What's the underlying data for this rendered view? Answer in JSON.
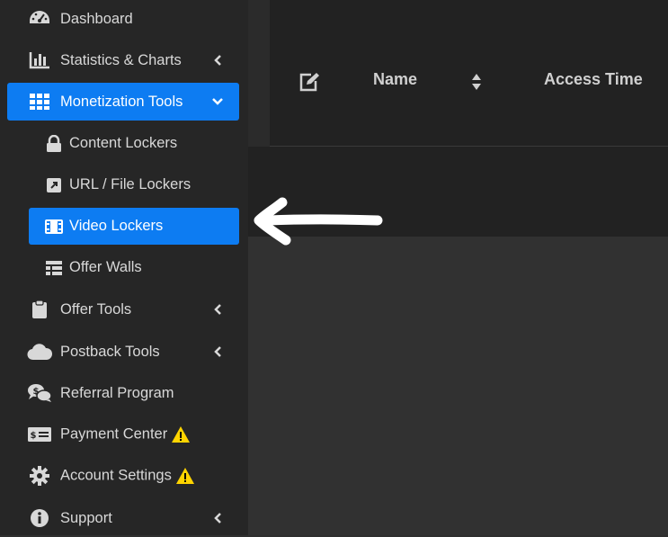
{
  "sidebar": {
    "items": [
      {
        "label": "Dashboard",
        "icon": "dashboard-gauge-icon"
      },
      {
        "label": "Statistics & Charts",
        "icon": "bar-chart-icon"
      },
      {
        "label": "Monetization Tools",
        "icon": "grid-icon",
        "active": true
      },
      {
        "label": "Content Lockers",
        "icon": "lock-icon"
      },
      {
        "label": "URL / File Lockers",
        "icon": "external-link-icon"
      },
      {
        "label": "Video Lockers",
        "icon": "film-icon",
        "active": true
      },
      {
        "label": "Offer Walls",
        "icon": "table-icon"
      },
      {
        "label": "Offer Tools",
        "icon": "clipboard-icon"
      },
      {
        "label": "Postback Tools",
        "icon": "cloud-icon"
      },
      {
        "label": "Referral Program",
        "icon": "chat-dollar-icon"
      },
      {
        "label": "Payment Center",
        "icon": "money-card-icon"
      },
      {
        "label": "Account Settings",
        "icon": "gear-icon"
      },
      {
        "label": "Support",
        "icon": "info-icon"
      }
    ]
  },
  "table": {
    "headers": {
      "name": "Name",
      "access_time": "Access Time"
    }
  },
  "colors": {
    "accent": "#0d7cf2",
    "warning": "#ffd400"
  }
}
